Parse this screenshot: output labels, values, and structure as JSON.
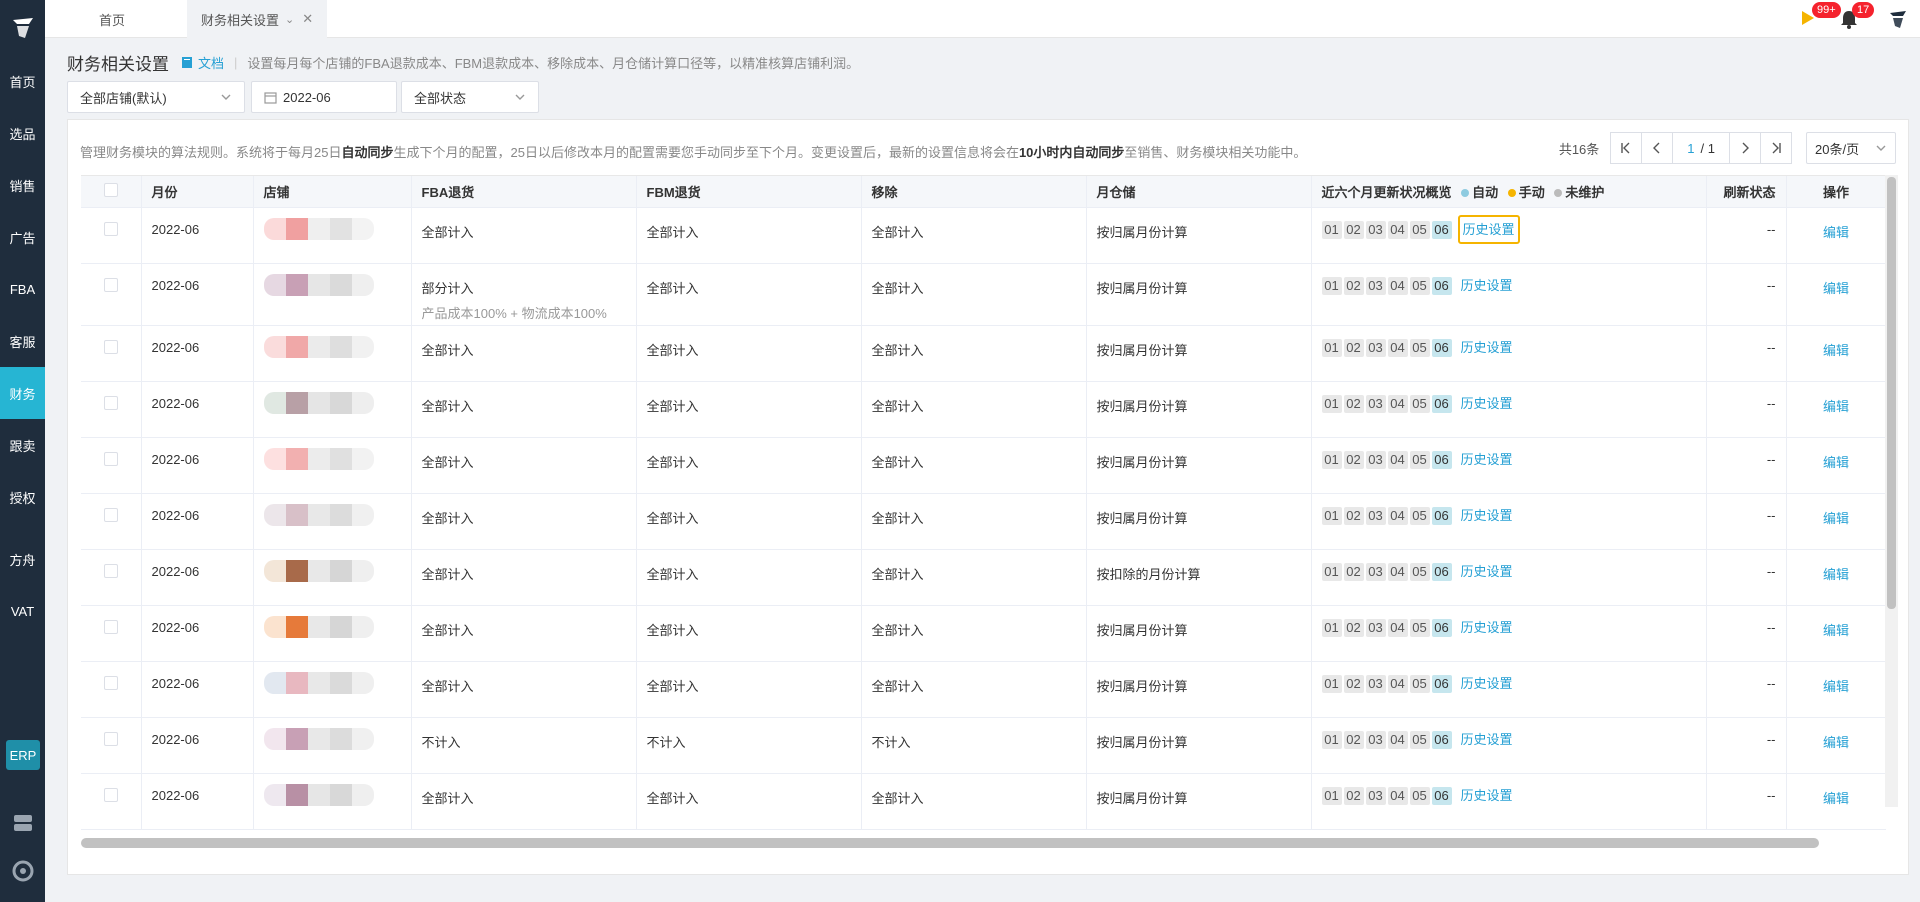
{
  "sidebar": {
    "items": [
      {
        "label": "首页"
      },
      {
        "label": "选品"
      },
      {
        "label": "销售"
      },
      {
        "label": "广告"
      },
      {
        "label": "FBA"
      },
      {
        "label": "客服"
      },
      {
        "label": "财务",
        "active": true
      },
      {
        "label": "跟卖"
      },
      {
        "label": "授权"
      },
      {
        "label": "方舟"
      },
      {
        "label": "VAT"
      }
    ],
    "erp_label": "ERP",
    "active_color": "#26b5d3",
    "bg_color": "#1f2d3d"
  },
  "topbar": {
    "tabs": [
      {
        "label": "首页"
      },
      {
        "label": "财务相关设置"
      }
    ],
    "notice_badge": "99+",
    "bell_badge": "17"
  },
  "header": {
    "title": "财务相关设置",
    "doc_label": "文档",
    "description": "设置每月每个店铺的FBA退款成本、FBM退款成本、移除成本、月仓储计算口径等，以精准核算店铺利润。"
  },
  "filters": {
    "shop": "全部店铺(默认)",
    "month": "2022-06",
    "status": "全部状态"
  },
  "rules": {
    "part1": "管理财务模块的算法规则。系统将于每月25日",
    "bold1": "自动同步",
    "part2": "生成下个月的配置，25日以后修改本月的配置需要您手动同步至下个月。变更设置后，最新的设置信息将会在",
    "bold2": "10小时内自动同步",
    "part3": "至销售、财务模块相关功能中。"
  },
  "pager": {
    "total": "共16条",
    "current": "1",
    "pages": "/ 1",
    "page_size": "20条/页"
  },
  "table": {
    "headers": {
      "month": "月份",
      "shop": "店铺",
      "fba": "FBA退货",
      "fbm": "FBM退货",
      "remove": "移除",
      "storage": "月仓储",
      "recent": "近六个月更新状况概览",
      "legend_auto": "自动",
      "legend_manual": "手动",
      "legend_none": "未维护",
      "refresh": "刷新状态",
      "action": "操作"
    },
    "months": [
      "01",
      "02",
      "03",
      "04",
      "05",
      "06"
    ],
    "history_label": "历史设置",
    "edit_label": "编辑",
    "rows": [
      {
        "month": "2022-06",
        "fba": "全部计入",
        "fba_sub": "",
        "fbm": "全部计入",
        "remove": "全部计入",
        "storage": "按归属月份计算",
        "refresh": "--",
        "highlight": true
      },
      {
        "month": "2022-06",
        "fba": "部分计入",
        "fba_sub": "产品成本100% + 物流成本100%",
        "fbm": "全部计入",
        "remove": "全部计入",
        "storage": "按归属月份计算",
        "refresh": "--",
        "highlight": false
      },
      {
        "month": "2022-06",
        "fba": "全部计入",
        "fba_sub": "",
        "fbm": "全部计入",
        "remove": "全部计入",
        "storage": "按归属月份计算",
        "refresh": "--",
        "highlight": false
      },
      {
        "month": "2022-06",
        "fba": "全部计入",
        "fba_sub": "",
        "fbm": "全部计入",
        "remove": "全部计入",
        "storage": "按归属月份计算",
        "refresh": "--",
        "highlight": false
      },
      {
        "month": "2022-06",
        "fba": "全部计入",
        "fba_sub": "",
        "fbm": "全部计入",
        "remove": "全部计入",
        "storage": "按归属月份计算",
        "refresh": "--",
        "highlight": false
      },
      {
        "month": "2022-06",
        "fba": "全部计入",
        "fba_sub": "",
        "fbm": "全部计入",
        "remove": "全部计入",
        "storage": "按归属月份计算",
        "refresh": "--",
        "highlight": false
      },
      {
        "month": "2022-06",
        "fba": "全部计入",
        "fba_sub": "",
        "fbm": "全部计入",
        "remove": "全部计入",
        "storage": "按扣除的月份计算",
        "refresh": "--",
        "highlight": false
      },
      {
        "month": "2022-06",
        "fba": "全部计入",
        "fba_sub": "",
        "fbm": "全部计入",
        "remove": "全部计入",
        "storage": "按归属月份计算",
        "refresh": "--",
        "highlight": false
      },
      {
        "month": "2022-06",
        "fba": "全部计入",
        "fba_sub": "",
        "fbm": "全部计入",
        "remove": "全部计入",
        "storage": "按归属月份计算",
        "refresh": "--",
        "highlight": false
      },
      {
        "month": "2022-06",
        "fba": "不计入",
        "fba_sub": "",
        "fbm": "不计入",
        "remove": "不计入",
        "storage": "按归属月份计算",
        "refresh": "--",
        "highlight": false
      },
      {
        "month": "2022-06",
        "fba": "全部计入",
        "fba_sub": "",
        "fbm": "全部计入",
        "remove": "全部计入",
        "storage": "按归属月份计算",
        "refresh": "--",
        "highlight": false
      }
    ]
  },
  "colors": {
    "link": "#26a0d4",
    "highlight_border": "#f5b400",
    "legend_auto": "#8ecbe0",
    "legend_manual": "#f5b400",
    "legend_none": "#bbbbbb",
    "badge": "#f5222d"
  }
}
